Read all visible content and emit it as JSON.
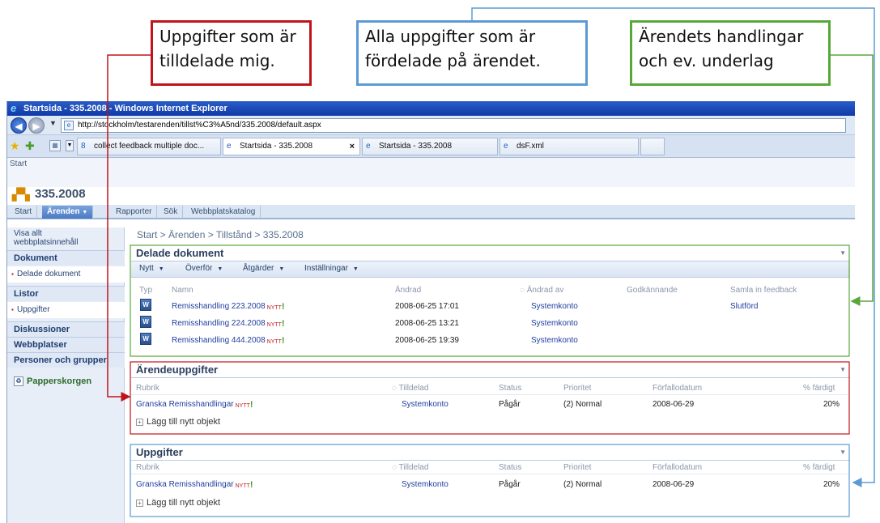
{
  "callouts": {
    "mine": [
      "Uppgifter som är",
      "tilldelade mig."
    ],
    "all": [
      "Alla uppgifter som är",
      "fördelade på ärendet."
    ],
    "documents": [
      "Ärendets handlingar",
      "och ev. underlag"
    ]
  },
  "colors": {
    "red": "#c0141b",
    "blue": "#5b9bd5",
    "green": "#58a839"
  },
  "browser": {
    "window_title": "Startsida - 335.2008 - Windows Internet Explorer",
    "url": "http://stockholm/testarenden/tillst%C3%A5nd/335.2008/default.aspx",
    "tabs": [
      {
        "label": "collect feedback multiple doc..."
      },
      {
        "label": "Startsida - 335.2008",
        "close": "×"
      },
      {
        "label": "Startsida - 335.2008"
      },
      {
        "label": "dsF.xml"
      },
      {
        "label": ""
      }
    ]
  },
  "site": {
    "top_breadcrumb": "Start",
    "title": "335.2008",
    "nav": [
      "Start",
      "Ärenden",
      "Rapporter",
      "Sök",
      "Webbplatskatalog"
    ],
    "selected_nav": "Ärenden"
  },
  "quicklaunch": {
    "view_all": [
      "Visa allt",
      "webbplatsinnehåll"
    ],
    "documents_head": "Dokument",
    "documents_item": "Delade dokument",
    "lists_head": "Listor",
    "lists_item": "Uppgifter",
    "discussions": "Diskussioner",
    "sites": "Webbplatser",
    "people": "Personer och grupper",
    "recycle": "Papperskorgen"
  },
  "breadcrumb": "Start > Ärenden > Tillstånd > 335.2008",
  "shared_docs": {
    "title": "Delade dokument",
    "toolbar": [
      "Nytt",
      "Överför",
      "Åtgärder",
      "Inställningar"
    ],
    "columns": [
      "Typ",
      "Namn",
      "Ändrad",
      "Ändrad av",
      "Godkännande",
      "Samla in feedback"
    ],
    "rows": [
      {
        "name": "Remisshandling 223.2008",
        "modified": "2008-06-25 17:01",
        "by": "Systemkonto",
        "feedback": "Slutförd"
      },
      {
        "name": "Remisshandling 224.2008",
        "modified": "2008-06-25 13:21",
        "by": "Systemkonto",
        "feedback": ""
      },
      {
        "name": "Remisshandling 444.2008",
        "modified": "2008-06-25 19:39",
        "by": "Systemkonto",
        "feedback": ""
      }
    ]
  },
  "new_badge": "NYTT",
  "case_tasks": {
    "title": "Ärendeuppgifter",
    "columns": [
      "Rubrik",
      "Tilldelad",
      "Status",
      "Prioritet",
      "Förfallodatum",
      "% färdigt"
    ],
    "row": {
      "title": "Granska Remisshandlingar",
      "assigned": "Systemkonto",
      "status": "Pågår",
      "priority": "(2) Normal",
      "due": "2008-06-29",
      "done": "20%"
    },
    "add": "Lägg till nytt objekt"
  },
  "tasks": {
    "title": "Uppgifter",
    "columns": [
      "Rubrik",
      "Tilldelad",
      "Status",
      "Prioritet",
      "Förfallodatum",
      "% färdigt"
    ],
    "row": {
      "title": "Granska Remisshandlingar",
      "assigned": "Systemkonto",
      "status": "Pågår",
      "priority": "(2) Normal",
      "due": "2008-06-29",
      "done": "20%"
    },
    "add": "Lägg till nytt objekt"
  }
}
